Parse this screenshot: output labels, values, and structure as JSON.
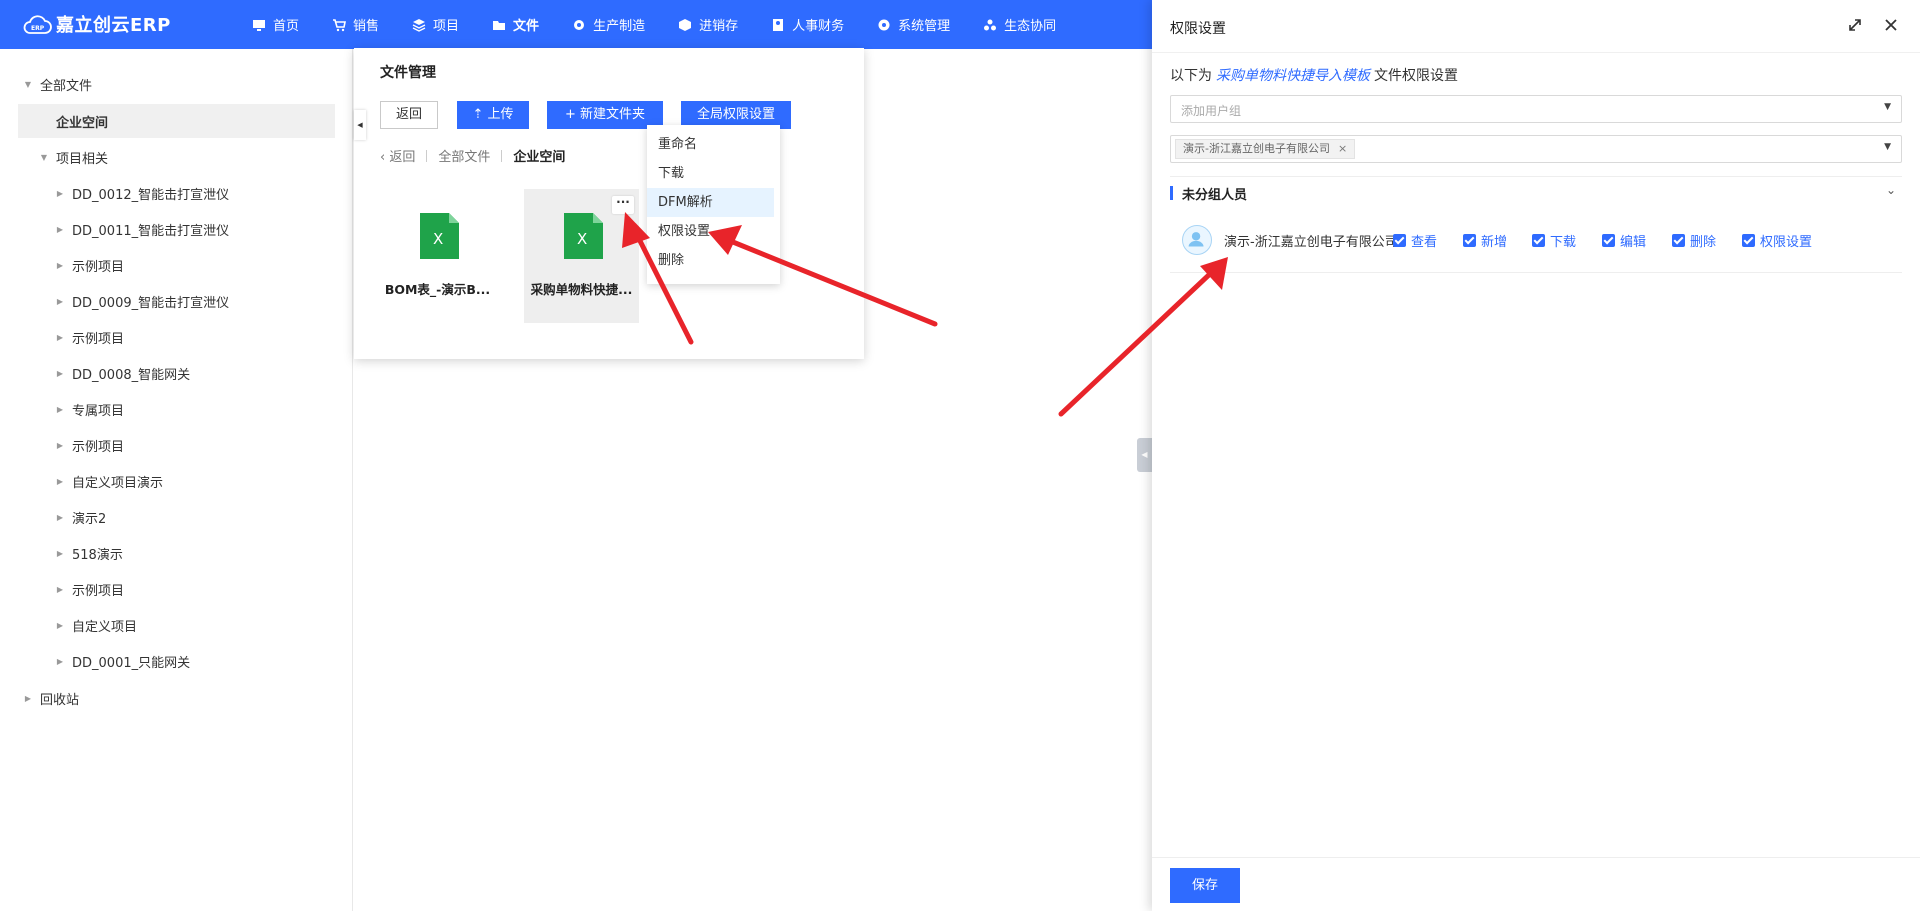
{
  "app": {
    "logo_text": "嘉立创云ERP",
    "logo_badge": "ERP"
  },
  "nav": [
    {
      "label": "首页",
      "icon": "monitor-icon"
    },
    {
      "label": "销售",
      "icon": "cart-icon"
    },
    {
      "label": "项目",
      "icon": "layers-icon"
    },
    {
      "label": "文件",
      "icon": "folder-icon",
      "active": true
    },
    {
      "label": "生产制造",
      "icon": "gear-icon"
    },
    {
      "label": "进销存",
      "icon": "box-icon"
    },
    {
      "label": "人事财务",
      "icon": "id-card-icon"
    },
    {
      "label": "系统管理",
      "icon": "settings-icon"
    },
    {
      "label": "生态协同",
      "icon": "network-icon"
    }
  ],
  "tree": {
    "root": "全部文件",
    "enterprise": "企业空间",
    "projects_group": "项目相关",
    "projects": [
      "DD_0012_智能击打宣泄仪",
      "DD_0011_智能击打宣泄仪",
      "示例项目",
      "DD_0009_智能击打宣泄仪",
      "示例项目",
      "DD_0008_智能网关",
      "专属项目",
      "示例项目",
      "自定义项目演示",
      "演示2",
      "518演示",
      "示例项目",
      "自定义项目",
      "DD_0001_只能网关"
    ],
    "recycle": "回收站"
  },
  "file_manager": {
    "title": "文件管理",
    "back_btn": "返回",
    "upload_btn": "上传",
    "new_folder_btn": "新建文件夹",
    "global_perm_btn": "全局权限设置",
    "breadcrumb": {
      "back": "返回",
      "all": "全部文件",
      "current": "企业空间"
    },
    "files": [
      {
        "name": "BOM表_-演示B...",
        "type": "xlsx"
      },
      {
        "name": "采购单物料快捷...",
        "type": "xlsx"
      }
    ],
    "more": "···"
  },
  "context_menu": [
    "重命名",
    "下载",
    "DFM解析",
    "权限设置",
    "删除"
  ],
  "drawer": {
    "title": "权限设置",
    "intro_prefix": "以下为",
    "file_name": "采购单物料快捷导入模板",
    "intro_suffix": "文件权限设置",
    "add_group_placeholder": "添加用户组",
    "selected_company_tag": "演示-浙江嘉立创电子有限公司",
    "group_label": "未分组人员",
    "member": {
      "name": "演示-浙江嘉立创电子有限公司",
      "permissions": [
        "查看",
        "新增",
        "下载",
        "编辑",
        "删除",
        "权限设置"
      ]
    },
    "save_btn": "保存"
  },
  "colors": {
    "primary": "#2f6bff",
    "arrow": "#e8242a",
    "excel": "#1fa34a"
  }
}
